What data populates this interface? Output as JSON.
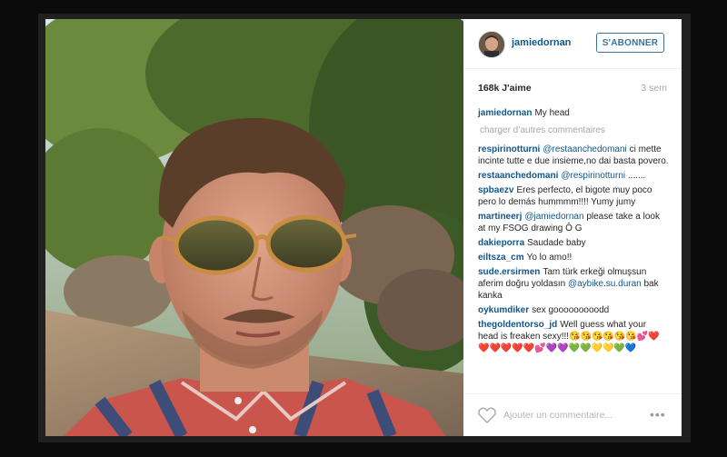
{
  "post": {
    "username": "jamiedornan",
    "follow_label": "S'ABONNER",
    "likes": "168k J'aime",
    "time": "3 sem",
    "caption": {
      "user": "jamiedornan",
      "text": "My head"
    },
    "load_more": "charger d’autres commentaires",
    "comments": [
      {
        "user": "respirinotturni",
        "mention": "@restaanchedomani",
        "text": "ci mette incinte tutte e due insieme,no dai basta povero."
      },
      {
        "user": "restaanchedomani",
        "mention": "@respirinotturni",
        "text": "......."
      },
      {
        "user": "spbaezv",
        "mention": "",
        "text": "Eres perfecto, el bigote muy poco pero lo demás hummmm!!!! Yumy jumy"
      },
      {
        "user": "martineerj",
        "mention": "@jamiedornan",
        "text": "please take a look at my FSOG drawing Ô G"
      },
      {
        "user": "dakieporra",
        "mention": "",
        "text": "Saudade baby"
      },
      {
        "user": "eiltsza_cm",
        "mention": "",
        "text": "Yo lo amo!!"
      },
      {
        "user": "sude.ersirmen",
        "mention": "",
        "text": "Tam türk erkeği olmuşsun aferim doğru yoldasın"
      },
      {
        "user": "oykumdiker",
        "mention": "",
        "text": "sex gooooooooodd"
      },
      {
        "user": "thegoldentorso_jd",
        "mention": "",
        "text": "Well guess what your head is freaken sexy!!!😘😘😘😘😘😘💕❤️❤️❤️❤️❤️❤️💕💜💜💚💚💛💛💚💙"
      }
    ],
    "sude_mention": "@aybike.su.duran",
    "sude_tail": "bak kanka",
    "add_comment_placeholder": "Ajouter un commentaire...",
    "more_label": "•••"
  },
  "colors": {
    "link": "#125688",
    "follow": "#3f729b",
    "muted": "#a5a7aa"
  }
}
